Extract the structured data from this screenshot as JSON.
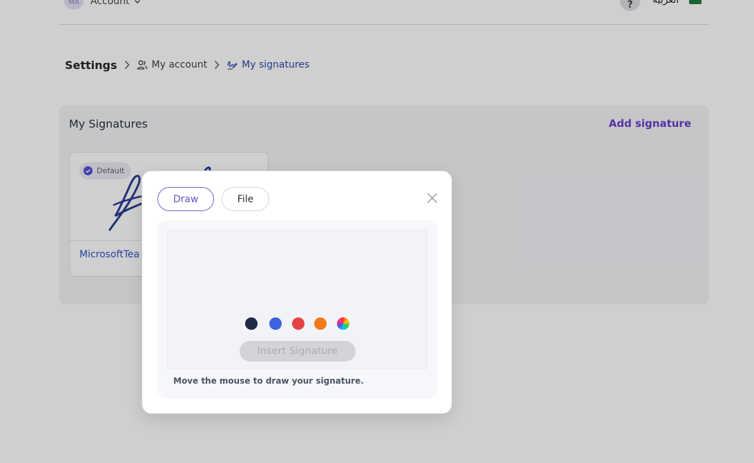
{
  "topbar": {
    "avatar_initials": "MA",
    "account_label": "Account",
    "help_label": "?",
    "language_label": "العربية"
  },
  "breadcrumb": {
    "root": "Settings",
    "items": [
      {
        "label": "My account",
        "icon": "users-icon"
      },
      {
        "label": "My signatures",
        "icon": "signature-icon"
      }
    ]
  },
  "signatures": {
    "title": "My Signatures",
    "add_label": "Add signature",
    "list": [
      {
        "badge": "Default",
        "name": "MicrosoftTea"
      }
    ]
  },
  "modal": {
    "tabs": [
      {
        "label": "Draw",
        "active": true
      },
      {
        "label": "File",
        "active": false
      }
    ],
    "colors": [
      "#1f2a44",
      "#3f62e0",
      "#e64346",
      "#f27a1a",
      "conic-multicolor"
    ],
    "insert_label": "Insert Signature",
    "hint": "Move the mouse to draw your signature."
  },
  "theme": {
    "accent": "#6a3ec9",
    "link": "#3150c8"
  }
}
